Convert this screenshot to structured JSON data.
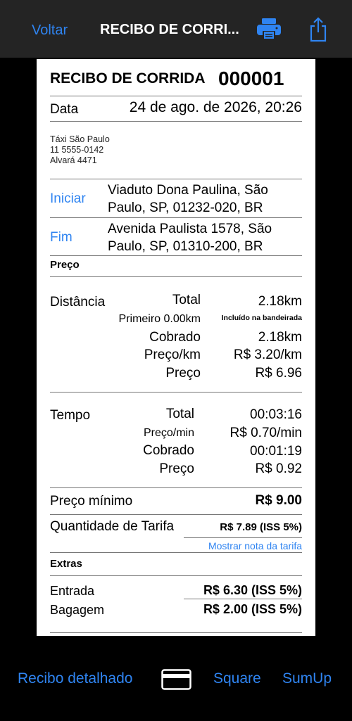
{
  "navbar": {
    "back_label": "Voltar",
    "title": "RECIBO DE CORRI...",
    "print_icon": "printer-icon",
    "share_icon": "share-icon"
  },
  "receipt": {
    "title": "RECIBO DE CORRIDA",
    "number": "000001",
    "date_label": "Data",
    "date_value": "24 de ago. de 2026, 20:26",
    "company": {
      "name": "Táxi São Paulo",
      "phone": "11 5555-0142",
      "license": "Alvará 4471"
    },
    "start_label": "Iniciar",
    "start_address": "Viaduto Dona Paulina, São Paulo, SP, 01232-020, BR",
    "end_label": "Fim",
    "end_address": "Avenida Paulista 1578, São Paulo, SP, 01310-200, BR",
    "price_section": "Preço",
    "distance": {
      "label": "Distância",
      "total_label": "Total",
      "total_value": "2.18km",
      "first_label": "Primeiro 0.00km",
      "first_value": "Incluído na bandeirada",
      "charged_label": "Cobrado",
      "charged_value": "2.18km",
      "rate_label": "Preço/km",
      "rate_value": "R$ 3.20/km",
      "price_label": "Preço",
      "price_value": "R$ 6.96"
    },
    "time": {
      "label": "Tempo",
      "total_label": "Total",
      "total_value": "00:03:16",
      "rate_label": "Preço/min",
      "rate_value": "R$ 0.70/min",
      "charged_label": "Cobrado",
      "charged_value": "00:01:19",
      "price_label": "Preço",
      "price_value": "R$ 0.92"
    },
    "minimum_label": "Preço mínimo",
    "minimum_value": "R$ 9.00",
    "fare_label": "Quantidade de Tarifa",
    "fare_value": "R$ 7.89 (ISS 5%)",
    "fare_note_link": "Mostrar nota da tarifa",
    "extras_section": "Extras",
    "entry_label": "Entrada",
    "entry_value": "R$ 6.30 (ISS 5%)",
    "luggage_label": "Bagagem",
    "luggage_value": "R$ 2.00 (ISS 5%)"
  },
  "toolbar": {
    "detailed_label": "Recibo detalhado",
    "card_icon": "credit-card-icon",
    "square_label": "Square",
    "sumup_label": "SumUp"
  },
  "colors": {
    "accent": "#2f84f1",
    "navbar_bg": "#242424",
    "page_bg": "#000000"
  }
}
